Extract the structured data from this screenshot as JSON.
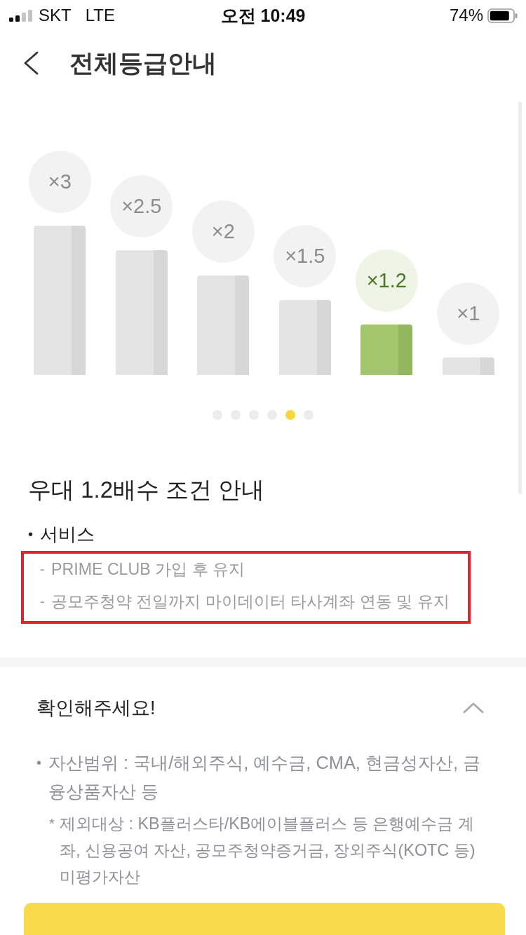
{
  "status_bar": {
    "carrier": "SKT",
    "network": "LTE",
    "time": "오전 10:49",
    "battery": "74%"
  },
  "header": {
    "title": "전체등급안내"
  },
  "tiers": [
    {
      "label": "×3",
      "selected": false
    },
    {
      "label": "×2.5",
      "selected": false
    },
    {
      "label": "×2",
      "selected": false
    },
    {
      "label": "×1.5",
      "selected": false
    },
    {
      "label": "×1.2",
      "selected": true
    },
    {
      "label": "×1",
      "selected": false
    }
  ],
  "page_dots": [
    {
      "selected": false
    },
    {
      "selected": false
    },
    {
      "selected": false
    },
    {
      "selected": false
    },
    {
      "selected": true
    },
    {
      "selected": false
    }
  ],
  "conditions": {
    "title": "우대 1.2배수 조건 안내",
    "groups": [
      {
        "marker": "•",
        "label": "서비스",
        "highlighted": true,
        "items": [
          {
            "marker": "-",
            "text": "PRIME CLUB 가입 후 유지"
          },
          {
            "marker": "-",
            "text": "공모주청약 전일까지 마이데이터 타사계좌 연동 및 유지"
          }
        ]
      }
    ]
  },
  "notice": {
    "title": "확인해주세요!",
    "expanded": true,
    "items": [
      {
        "marker": "•",
        "text": "자산범위 : 국내/해외주식, 예수금, CMA, 현금성자산, 금융상품자산 등",
        "notes": [
          {
            "marker": "*",
            "text": "제외대상 : KB플러스타/KB에이블플러스 등 은행예수금 계좌, 신용공여 자산, 공모주청약증거금, 장외주식(KOTC 등) 미평가자산"
          }
        ]
      }
    ]
  },
  "bottom_button": {
    "kind": "primary"
  }
}
